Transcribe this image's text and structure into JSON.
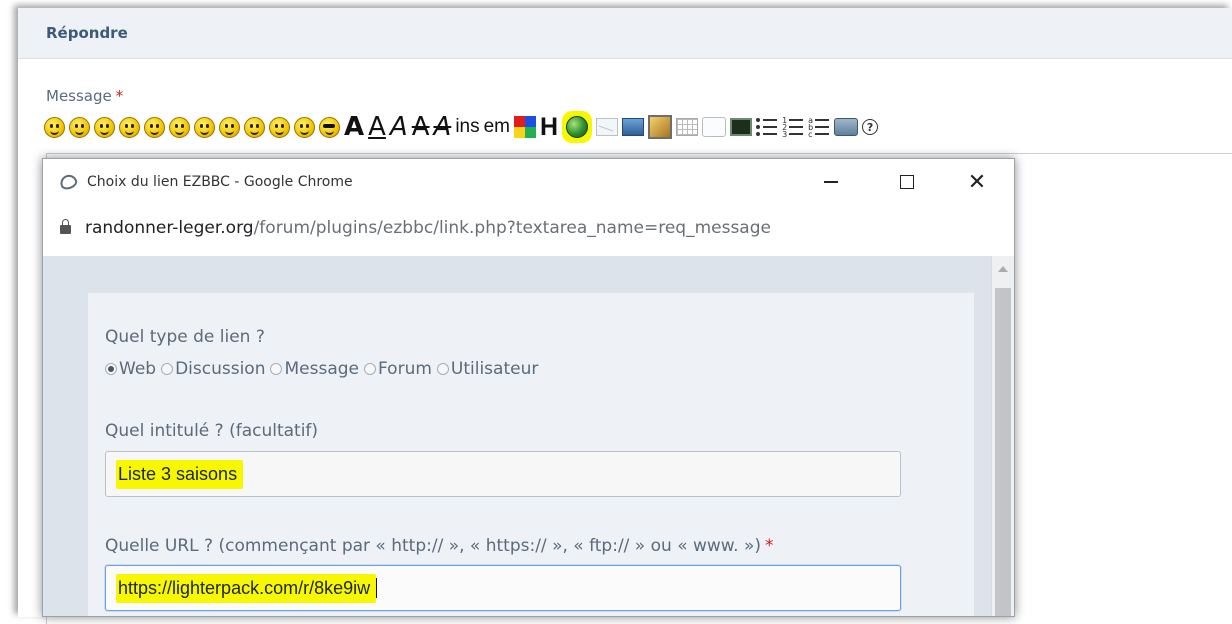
{
  "reply": {
    "title": "Répondre",
    "message_label": "Message",
    "required_mark": "*"
  },
  "toolbar": {
    "smileys": [
      "smile",
      "neutral",
      "sad",
      "surprised",
      "big-grin",
      "wink",
      "happy",
      "tongue",
      "lol",
      "mad",
      "rolleyes",
      "cool"
    ],
    "bold": "A",
    "underline": "A",
    "italic": "A",
    "strike": "A",
    "strike_italic": "A",
    "ins": "ins",
    "em": "em",
    "heading": "H",
    "help": "?",
    "highlight_color": "#f7f700"
  },
  "popup": {
    "window_title": "Choix du lien EZBBC - Google Chrome",
    "url_host": "randonner-leger.org",
    "url_path": "/forum/plugins/ezbbc/link.php?textarea_name=req_message",
    "close_glyph": "✕",
    "link_type_label": "Quel type de lien ?",
    "link_types": [
      {
        "label": "Web",
        "checked": true
      },
      {
        "label": "Discussion",
        "checked": false
      },
      {
        "label": "Message",
        "checked": false
      },
      {
        "label": "Forum",
        "checked": false
      },
      {
        "label": "Utilisateur",
        "checked": false
      }
    ],
    "title_field_label": "Quel intitulé ? (facultatif)",
    "title_field_value": "Liste 3 saisons",
    "url_field_label": "Quelle URL ? (commençant par « http:// », « https:// », « ftp:// » ou « www. »)",
    "url_field_required": "*",
    "url_field_value": "https://lighterpack.com/r/8ke9iw"
  },
  "colors": {
    "highlight": "#f7f700",
    "required": "#d02020",
    "header_text": "#3f5a77",
    "panel_bg": "#eef1f5",
    "content_bg": "#dde3ea"
  }
}
